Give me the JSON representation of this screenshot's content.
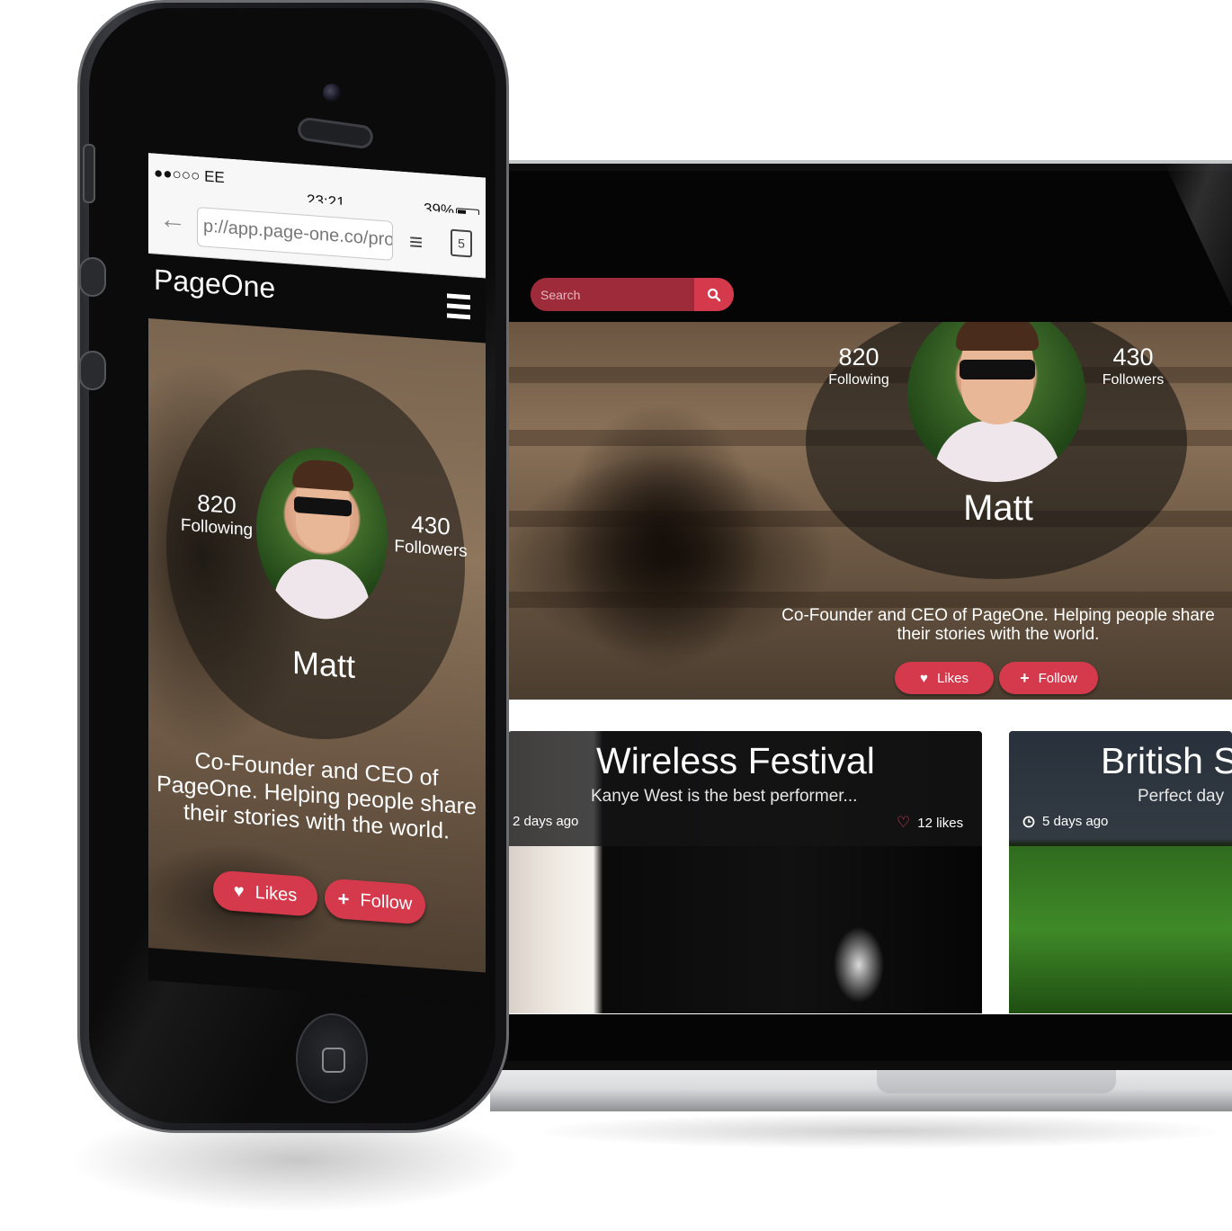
{
  "web": {
    "search": {
      "placeholder": "Search"
    },
    "profile": {
      "following_count": "820",
      "following_label": "Following",
      "followers_count": "430",
      "followers_label": "Followers",
      "name": "Matt",
      "bio": "Co-Founder and CEO of PageOne. Helping people share their stories with the world."
    },
    "actions": {
      "likes_label": "Likes",
      "follow_label": "Follow"
    },
    "cards": [
      {
        "title": "Wireless Festival",
        "subtitle": "Kanye West is the best performer...",
        "time": "2 days ago",
        "likes": "12 likes"
      },
      {
        "title": "British S",
        "subtitle": "Perfect day",
        "time": "5 days ago"
      }
    ]
  },
  "mobile": {
    "status": {
      "carrier": "●●○○○ EE",
      "time": "23:21",
      "battery": "39%"
    },
    "browser": {
      "url": "p://app.page-one.co/prof",
      "tab_count": "5"
    },
    "app": {
      "logo": "PageOne"
    },
    "profile": {
      "following_count": "820",
      "following_label": "Following",
      "followers_count": "430",
      "followers_label": "Followers",
      "name": "Matt",
      "bio": "Co-Founder and CEO of PageOne. Helping people share their stories with the world."
    },
    "actions": {
      "likes_label": "Likes",
      "follow_label": "Follow"
    }
  },
  "colors": {
    "accent": "#d43a4c",
    "search_bg": "#9d2b39",
    "header_bg": "#050505",
    "card_overlay": "#141416"
  }
}
